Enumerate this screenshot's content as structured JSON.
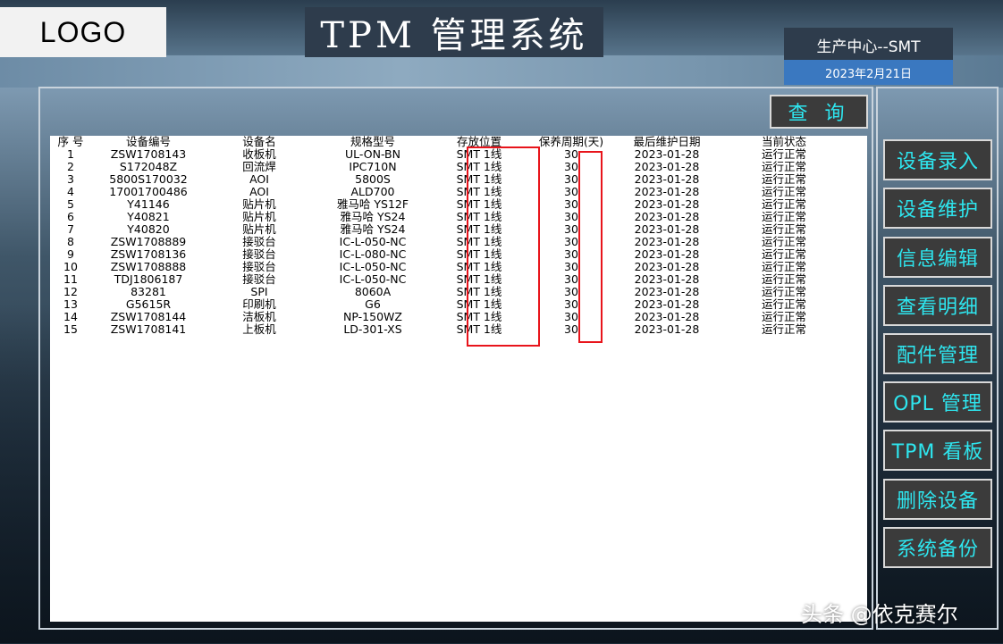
{
  "header": {
    "logo": "LOGO",
    "title": "TPM 管理系统",
    "department": "生产中心--SMT",
    "date": "2023年2月21日"
  },
  "query_button": "查 询",
  "table": {
    "headers": [
      "序 号",
      "设备编号",
      "设备名",
      "规格型号",
      "存放位置",
      "保养周期(天)",
      "最后维护日期",
      "当前状态"
    ],
    "rows": [
      [
        "1",
        "ZSW1708143",
        "收板机",
        "UL-ON-BN",
        "SMT 1线",
        "30",
        "2023-01-28",
        "运行正常"
      ],
      [
        "2",
        "S172048Z",
        "回流焊",
        "IPC710N",
        "SMT 1线",
        "30",
        "2023-01-28",
        "运行正常"
      ],
      [
        "3",
        "5800S170032",
        "AOI",
        "5800S",
        "SMT 1线",
        "30",
        "2023-01-28",
        "运行正常"
      ],
      [
        "4",
        "17001700486",
        "AOI",
        "ALD700",
        "SMT 1线",
        "30",
        "2023-01-28",
        "运行正常"
      ],
      [
        "5",
        "Y41146",
        "贴片机",
        "雅马哈 YS12F",
        "SMT 1线",
        "30",
        "2023-01-28",
        "运行正常"
      ],
      [
        "6",
        "Y40821",
        "贴片机",
        "雅马哈 YS24",
        "SMT 1线",
        "30",
        "2023-01-28",
        "运行正常"
      ],
      [
        "7",
        "Y40820",
        "贴片机",
        "雅马哈 YS24",
        "SMT 1线",
        "30",
        "2023-01-28",
        "运行正常"
      ],
      [
        "8",
        "ZSW1708889",
        "接驳台",
        "IC-L-050-NC",
        "SMT 1线",
        "30",
        "2023-01-28",
        "运行正常"
      ],
      [
        "9",
        "ZSW1708136",
        "接驳台",
        "IC-L-080-NC",
        "SMT 1线",
        "30",
        "2023-01-28",
        "运行正常"
      ],
      [
        "10",
        "ZSW1708888",
        "接驳台",
        "IC-L-050-NC",
        "SMT 1线",
        "30",
        "2023-01-28",
        "运行正常"
      ],
      [
        "11",
        "TDJ1806187",
        "接驳台",
        "IC-L-050-NC",
        "SMT 1线",
        "30",
        "2023-01-28",
        "运行正常"
      ],
      [
        "12",
        "83281",
        "SPI",
        "8060A",
        "SMT 1线",
        "30",
        "2023-01-28",
        "运行正常"
      ],
      [
        "13",
        "G5615R",
        "印刷机",
        "G6",
        "SMT 1线",
        "30",
        "2023-01-28",
        "运行正常"
      ],
      [
        "14",
        "ZSW1708144",
        "洁板机",
        "NP-150WZ",
        "SMT 1线",
        "30",
        "2023-01-28",
        "运行正常"
      ],
      [
        "15",
        "ZSW1708141",
        "上板机",
        "LD-301-XS",
        "SMT 1线",
        "30",
        "2023-01-28",
        "运行正常"
      ]
    ]
  },
  "side_menu": [
    "设备录入",
    "设备维护",
    "信息编辑",
    "查看明细",
    "配件管理",
    "OPL 管理",
    "TPM 看板",
    "删除设备",
    "系统备份"
  ],
  "watermark": "头条 @依克赛尔",
  "colors": {
    "button_text": "#2ee6ef",
    "button_bg": "#3b3b3b",
    "highlight": "#e8141b",
    "date_bg": "#3a78c0"
  }
}
